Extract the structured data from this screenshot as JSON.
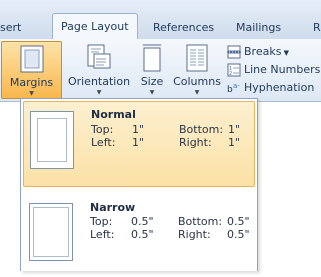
{
  "tabs": [
    "sert",
    "Page Layout",
    "References",
    "Mailings",
    "R"
  ],
  "ribbon": {
    "margins_label": "Margins",
    "orientation_label": "Orientation",
    "size_label": "Size",
    "columns_label": "Columns",
    "breaks_label": "Breaks",
    "line_numbers_label": "Line Numbers",
    "hyphenation_label": "Hyphenation",
    "active_color": "#f9b74d"
  },
  "margins_menu": [
    {
      "name": "Normal",
      "top_label": "Top:",
      "top_value": "1\"",
      "bottom_label": "Bottom:",
      "bottom_value": "1\"",
      "left_label": "Left:",
      "left_value": "1\"",
      "right_label": "Right:",
      "right_value": "1\""
    },
    {
      "name": "Narrow",
      "top_label": "Top:",
      "top_value": "0.5\"",
      "bottom_label": "Bottom:",
      "bottom_value": "0.5\"",
      "left_label": "Left:",
      "left_value": "0.5\"",
      "right_label": "Right:",
      "right_value": "0.5\""
    }
  ]
}
